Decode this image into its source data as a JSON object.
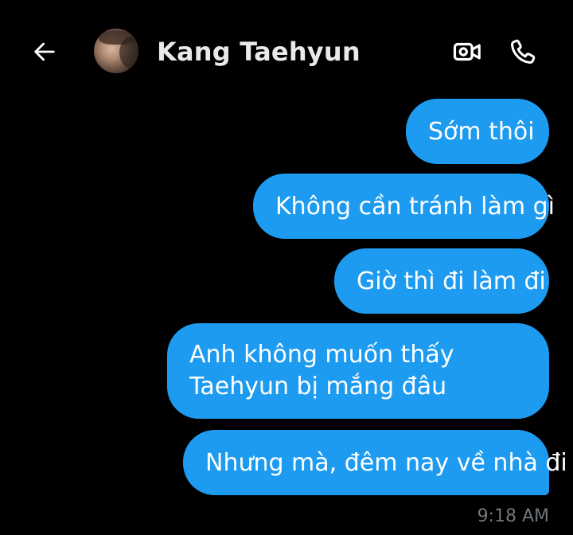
{
  "header": {
    "back_icon": "arrow-left-icon",
    "contact_name": "Kang Taehyun",
    "video_icon": "video-camera-icon",
    "call_icon": "phone-icon"
  },
  "messages": [
    {
      "text": "Sớm thôi",
      "sender": "me"
    },
    {
      "text": "Không cần tránh làm gì",
      "sender": "me"
    },
    {
      "text": "Giờ thì đi làm đi",
      "sender": "me"
    },
    {
      "text": "Anh không muốn thấy Taehyun bị mắng đâu",
      "sender": "me"
    },
    {
      "text": "Nhưng mà, đêm nay về nhà đi",
      "sender": "me"
    }
  ],
  "timestamp": "9:18 AM",
  "colors": {
    "background": "#000000",
    "bubble": "#1d9bf0",
    "name_text": "#e7e9ea",
    "timestamp_text": "#71767b"
  }
}
